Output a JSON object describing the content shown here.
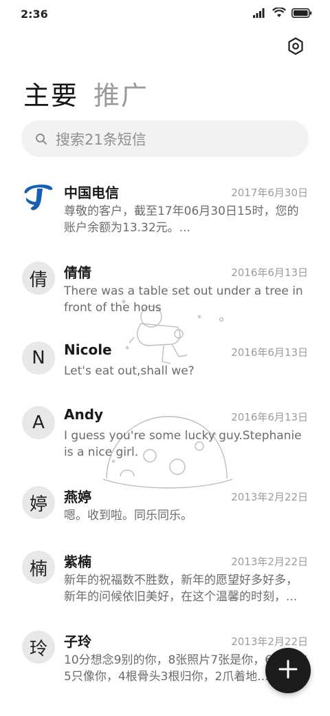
{
  "status_bar": {
    "time": "2:36",
    "icons": [
      "signal-icon",
      "wifi-icon",
      "battery-icon"
    ]
  },
  "header": {
    "settings_icon": "settings-icon",
    "tabs": [
      {
        "label": "主要",
        "active": true
      },
      {
        "label": "推广",
        "active": false
      }
    ]
  },
  "search": {
    "placeholder": "搜索21条短信",
    "icon": "search-icon"
  },
  "messages": [
    {
      "avatar": "",
      "avatar_type": "china-telecom-logo",
      "name": "中国电信",
      "date": "2017年6月30日",
      "preview": "尊敬的客户，截至17年06月30日15时，您的账户余额为13.32元。..."
    },
    {
      "avatar": "倩",
      "avatar_type": "letter",
      "name": "倩倩",
      "date": "2016年6月13日",
      "preview": "There was a table set out under a tree in front of the hous"
    },
    {
      "avatar": "N",
      "avatar_type": "letter",
      "name": "Nicole",
      "date": "2016年6月13日",
      "preview": "Let's eat out,shall we?"
    },
    {
      "avatar": "A",
      "avatar_type": "letter",
      "name": "Andy",
      "date": "2016年6月13日",
      "preview": "I guess you're some lucky guy.Stephanie is a nice girl."
    },
    {
      "avatar": "婷",
      "avatar_type": "letter",
      "name": "燕婷",
      "date": "2013年2月22日",
      "preview": "嗯。收到啦。同乐同乐。"
    },
    {
      "avatar": "楠",
      "avatar_type": "letter",
      "name": "紫楠",
      "date": "2013年2月22日",
      "preview": "新年的祝福数不胜数，新年的愿望好多好多，新年的问候依旧美好，在这个温馨的时刻，..."
    },
    {
      "avatar": "玲",
      "avatar_type": "letter",
      "name": "子玲",
      "date": "2013年2月22日",
      "preview": "10分想念9别的你，8张照片7张是你，6只小狗5只像你，4根骨头3根归你，2爪着地..."
    }
  ],
  "fab": {
    "icon": "plus-icon"
  },
  "colors": {
    "background": "#ffffff",
    "telecom_blue": "#1660b4",
    "fab": "#1c1c1c",
    "avatar_bg": "#e8e8e8"
  }
}
